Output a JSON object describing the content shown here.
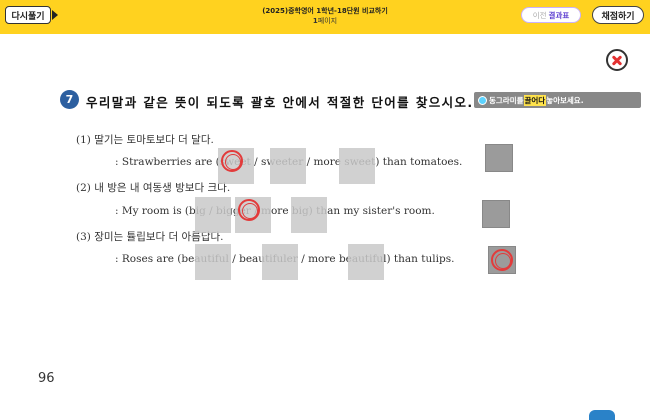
{
  "topbar": {
    "retry_label": "다시풀기",
    "title": "(2025)중학영어 1학년-18단원 비교하기",
    "page_number": "1",
    "page_suffix": "페이지",
    "result_prefix": "이전",
    "result_label": "결과표",
    "grade_label": "채점하기"
  },
  "question": {
    "number": "7",
    "text": "우리말과 같은 뜻이 되도록 괄호 안에서 적절한 단어를 찾으시오.",
    "hint_pre": "동그라미를",
    "hint_highlight": "끌어다",
    "hint_post": "놓아보세요."
  },
  "items": [
    {
      "korean": "(1) 딸기는 토마토보다 더 달다.",
      "english": ": Strawberries are (sweet / sweeter / more sweet) than tomatoes."
    },
    {
      "korean": "(2) 내 방은 내 여동생 방보다 크다.",
      "english": ": My room is (big / bigger / more big) than my sister's room."
    },
    {
      "korean": "(3) 장미는 튤립보다 더 아름답다.",
      "english": ": Roses are (beautiful / beautifuler / more beautiful) than tulips."
    }
  ],
  "footer": {
    "page": "96"
  },
  "icons": {
    "close": "close-icon",
    "circle_marker": "circle-marker-icon",
    "play": "play-arrow-icon"
  },
  "colors": {
    "topbar": "#ffd21f",
    "accent_blue": "#2c5fa0",
    "marker_red": "#e23b3b"
  }
}
